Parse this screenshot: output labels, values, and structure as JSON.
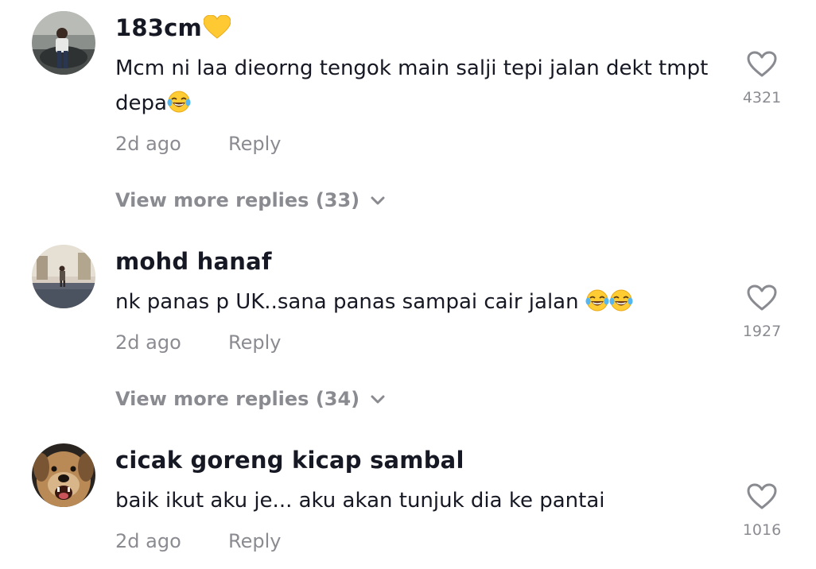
{
  "comments": [
    {
      "username": "183cm",
      "username_emoji": "yellow-heart",
      "text": "Mcm ni laa dieorng tengok main salji tepi jalan dekt tmpt depa",
      "text_emojis": [
        "tears-of-joy"
      ],
      "time": "2d ago",
      "reply_label": "Reply",
      "likes": "4321",
      "view_more": "View more replies (33)"
    },
    {
      "username": "mohd hanaf",
      "text": "nk panas p UK..sana panas sampai cair jalan ",
      "text_emojis": [
        "tears-of-joy",
        "tears-of-joy"
      ],
      "time": "2d ago",
      "reply_label": "Reply",
      "likes": "1927",
      "view_more": "View more replies (34)"
    },
    {
      "username": "cicak goreng kicap sambal",
      "text": "baik ikut aku je... aku akan tunjuk dia ke pantai",
      "time": "2d ago",
      "reply_label": "Reply",
      "likes": "1016"
    }
  ],
  "colors": {
    "text_primary": "#161823",
    "text_secondary": "rgba(22,24,35,0.5)",
    "heart_outline": "#8a8b91"
  }
}
